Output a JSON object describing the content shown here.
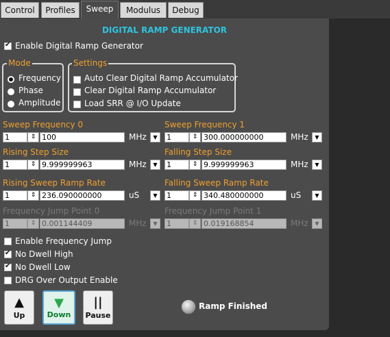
{
  "tabs": [
    "Control",
    "Profiles",
    "Sweep",
    "Modulus",
    "Debug"
  ],
  "active_tab": "Sweep",
  "title": "DIGITAL RAMP GENERATOR",
  "enable_drg": {
    "label": "Enable Digital Ramp Generator",
    "checked": true
  },
  "mode": {
    "legend": "Mode",
    "options": [
      "Frequency",
      "Phase",
      "Amplitude"
    ],
    "selected": "Frequency"
  },
  "settings": {
    "legend": "Settings",
    "items": [
      {
        "label": "Auto Clear Digital Ramp Accumulator",
        "checked": false
      },
      {
        "label": "Clear Digital Ramp Accumulator",
        "checked": false
      },
      {
        "label": "Load SRR @ I/O Update",
        "checked": false
      }
    ]
  },
  "fields": {
    "sweep_freq_0": {
      "label": "Sweep Frequency 0",
      "index": "1",
      "value": "100",
      "unit": "MHz"
    },
    "sweep_freq_1": {
      "label": "Sweep Frequency 1",
      "index": "1",
      "value": "300.000000000",
      "unit": "MHz"
    },
    "rising_step": {
      "label": "Rising Step Size",
      "index": "1",
      "value": "9.999999963",
      "unit": "MHz"
    },
    "falling_step": {
      "label": "Falling Step Size",
      "index": "1",
      "value": "9.999999963",
      "unit": "MHz"
    },
    "rising_rate": {
      "label": "Rising Sweep Ramp Rate",
      "index": "1",
      "value": "236.090000000",
      "unit": "uS"
    },
    "falling_rate": {
      "label": "Falling Sweep Ramp Rate",
      "index": "1",
      "value": "340.480000000",
      "unit": "uS"
    },
    "jump_0": {
      "label": "Frequency Jump Point 0",
      "index": "1",
      "value": "0.001144409",
      "unit": "MHz"
    },
    "jump_1": {
      "label": "Frequency Jump Point 1",
      "index": "1",
      "value": "0.019168854",
      "unit": "MHz"
    }
  },
  "options": [
    {
      "label": "Enable Frequency Jump",
      "checked": false
    },
    {
      "label": "No Dwell High",
      "checked": true
    },
    {
      "label": "No Dwell Low",
      "checked": true
    },
    {
      "label": "DRG Over Output Enable",
      "checked": false
    }
  ],
  "buttons": {
    "up": "Up",
    "down": "Down",
    "pause": "Pause"
  },
  "status": {
    "label": "Ramp Finished",
    "lit": false
  },
  "icons": {
    "spinner": "⇕",
    "dropdown": "▼",
    "up": "▲",
    "down": "▼",
    "pause": "||"
  },
  "colors": {
    "accent_title": "#2fc4de",
    "label_orange": "#f0a030",
    "down_active": "#2aa84a"
  }
}
